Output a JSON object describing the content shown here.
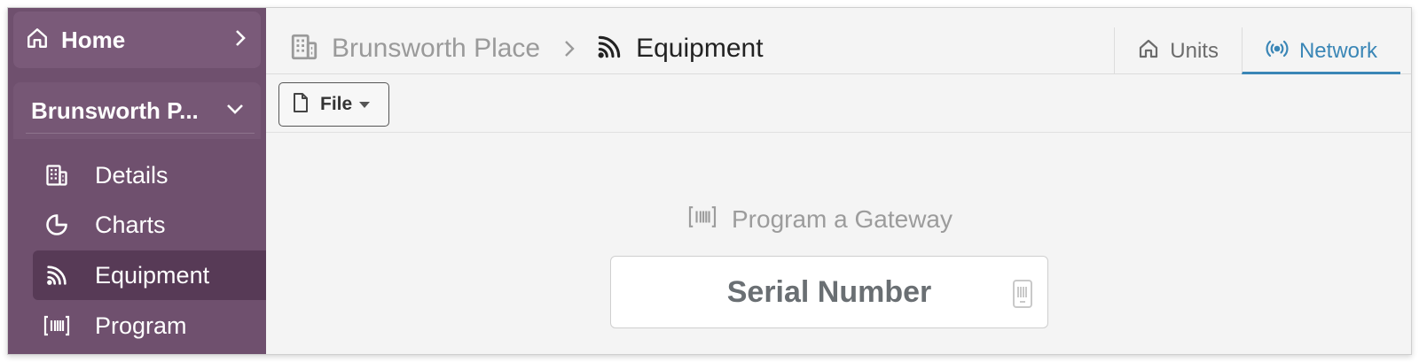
{
  "sidebar": {
    "home_label": "Home",
    "section_label": "Brunsworth P...",
    "items": [
      {
        "label": "Details"
      },
      {
        "label": "Charts"
      },
      {
        "label": "Equipment"
      },
      {
        "label": "Program"
      }
    ]
  },
  "header": {
    "breadcrumb_root": "Brunsworth Place",
    "breadcrumb_current": "Equipment"
  },
  "tabs": [
    {
      "label": "Units"
    },
    {
      "label": "Network"
    }
  ],
  "toolbar": {
    "file_label": "File"
  },
  "program": {
    "title": "Program a Gateway",
    "serial_placeholder": "Serial Number"
  },
  "colors": {
    "sidebar_bg": "#6f506e",
    "sidebar_active": "#573a56",
    "accent": "#3a86b6"
  }
}
